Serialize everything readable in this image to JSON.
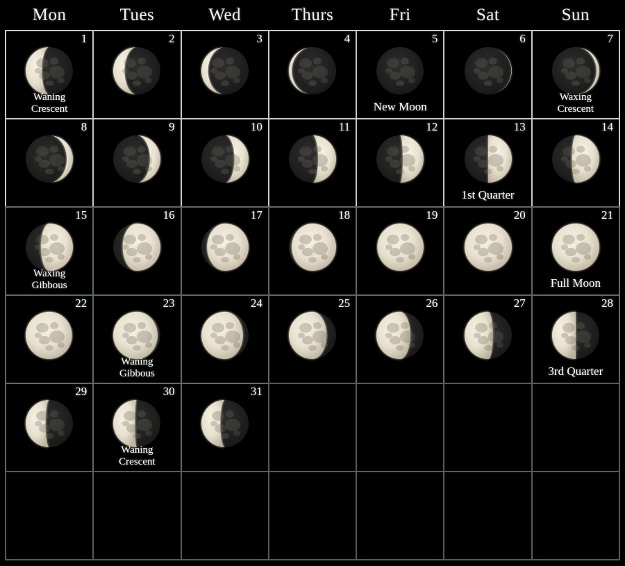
{
  "header": {
    "weekdays": [
      "Mon",
      "Tues",
      "Wed",
      "Thurs",
      "Fri",
      "Sat",
      "Sun"
    ]
  },
  "colors": {
    "background": "#000000",
    "grid_line_bright": "#c3c9cc",
    "grid_line_dim": "#5c6a6c",
    "text": "#ffffff",
    "moon_lit": "#e8e0cf",
    "moon_dark": "#252525"
  },
  "calendar": {
    "columns": 7,
    "rows": 6,
    "days": [
      {
        "num": "1",
        "phase_label": "Waning\nCrescent",
        "illumination": 0.34,
        "waxing": false,
        "visible": true
      },
      {
        "num": "2",
        "phase_label": "",
        "illumination": 0.24,
        "waxing": false,
        "visible": true
      },
      {
        "num": "3",
        "phase_label": "",
        "illumination": 0.14,
        "waxing": false,
        "visible": true
      },
      {
        "num": "4",
        "phase_label": "",
        "illumination": 0.06,
        "waxing": false,
        "visible": true
      },
      {
        "num": "5",
        "phase_label": "New Moon",
        "illumination": 0.0,
        "waxing": false,
        "visible": true
      },
      {
        "num": "6",
        "phase_label": "",
        "illumination": 0.01,
        "waxing": true,
        "visible": true
      },
      {
        "num": "7",
        "phase_label": "Waxing\nCrescent",
        "illumination": 0.06,
        "waxing": true,
        "visible": true
      },
      {
        "num": "8",
        "phase_label": "",
        "illumination": 0.13,
        "waxing": true,
        "visible": true
      },
      {
        "num": "9",
        "phase_label": "",
        "illumination": 0.22,
        "waxing": true,
        "visible": true
      },
      {
        "num": "10",
        "phase_label": "",
        "illumination": 0.3,
        "waxing": true,
        "visible": true
      },
      {
        "num": "11",
        "phase_label": "",
        "illumination": 0.38,
        "waxing": true,
        "visible": true
      },
      {
        "num": "12",
        "phase_label": "",
        "illumination": 0.44,
        "waxing": true,
        "visible": true
      },
      {
        "num": "13",
        "phase_label": "1st Quarter",
        "illumination": 0.5,
        "waxing": true,
        "visible": true
      },
      {
        "num": "14",
        "phase_label": "",
        "illumination": 0.58,
        "waxing": true,
        "visible": true
      },
      {
        "num": "15",
        "phase_label": "Waxing\nGibbous",
        "illumination": 0.68,
        "waxing": true,
        "visible": true
      },
      {
        "num": "16",
        "phase_label": "",
        "illumination": 0.8,
        "waxing": true,
        "visible": true
      },
      {
        "num": "17",
        "phase_label": "",
        "illumination": 0.88,
        "waxing": true,
        "visible": true
      },
      {
        "num": "18",
        "phase_label": "",
        "illumination": 0.94,
        "waxing": true,
        "visible": true
      },
      {
        "num": "19",
        "phase_label": "",
        "illumination": 0.98,
        "waxing": true,
        "visible": true
      },
      {
        "num": "20",
        "phase_label": "",
        "illumination": 1.0,
        "waxing": true,
        "visible": true
      },
      {
        "num": "21",
        "phase_label": "Full Moon",
        "illumination": 1.0,
        "waxing": false,
        "visible": true
      },
      {
        "num": "22",
        "phase_label": "",
        "illumination": 0.98,
        "waxing": false,
        "visible": true
      },
      {
        "num": "23",
        "phase_label": "Waning\nGibbous",
        "illumination": 0.94,
        "waxing": false,
        "visible": true
      },
      {
        "num": "24",
        "phase_label": "",
        "illumination": 0.88,
        "waxing": false,
        "visible": true
      },
      {
        "num": "25",
        "phase_label": "",
        "illumination": 0.8,
        "waxing": false,
        "visible": true
      },
      {
        "num": "26",
        "phase_label": "",
        "illumination": 0.72,
        "waxing": false,
        "visible": true
      },
      {
        "num": "27",
        "phase_label": "",
        "illumination": 0.6,
        "waxing": false,
        "visible": true
      },
      {
        "num": "28",
        "phase_label": "3rd Quarter",
        "illumination": 0.5,
        "waxing": false,
        "visible": true
      },
      {
        "num": "29",
        "phase_label": "",
        "illumination": 0.42,
        "waxing": false,
        "visible": true
      },
      {
        "num": "30",
        "phase_label": "Waning\nCrescent",
        "illumination": 0.46,
        "waxing": false,
        "visible": true
      },
      {
        "num": "31",
        "phase_label": "",
        "illumination": 0.4,
        "waxing": false,
        "visible": true
      },
      {
        "num": "",
        "phase_label": "",
        "illumination": null,
        "waxing": false,
        "visible": false
      },
      {
        "num": "",
        "phase_label": "",
        "illumination": null,
        "waxing": false,
        "visible": false
      },
      {
        "num": "",
        "phase_label": "",
        "illumination": null,
        "waxing": false,
        "visible": false
      },
      {
        "num": "",
        "phase_label": "",
        "illumination": null,
        "waxing": false,
        "visible": false
      },
      {
        "num": "",
        "phase_label": "",
        "illumination": null,
        "waxing": false,
        "visible": false
      },
      {
        "num": "",
        "phase_label": "",
        "illumination": null,
        "waxing": false,
        "visible": false
      },
      {
        "num": "",
        "phase_label": "",
        "illumination": null,
        "waxing": false,
        "visible": false
      },
      {
        "num": "",
        "phase_label": "",
        "illumination": null,
        "waxing": false,
        "visible": false
      },
      {
        "num": "",
        "phase_label": "",
        "illumination": null,
        "waxing": false,
        "visible": false
      },
      {
        "num": "",
        "phase_label": "",
        "illumination": null,
        "waxing": false,
        "visible": false
      },
      {
        "num": "",
        "phase_label": "",
        "illumination": null,
        "waxing": false,
        "visible": false
      }
    ]
  }
}
